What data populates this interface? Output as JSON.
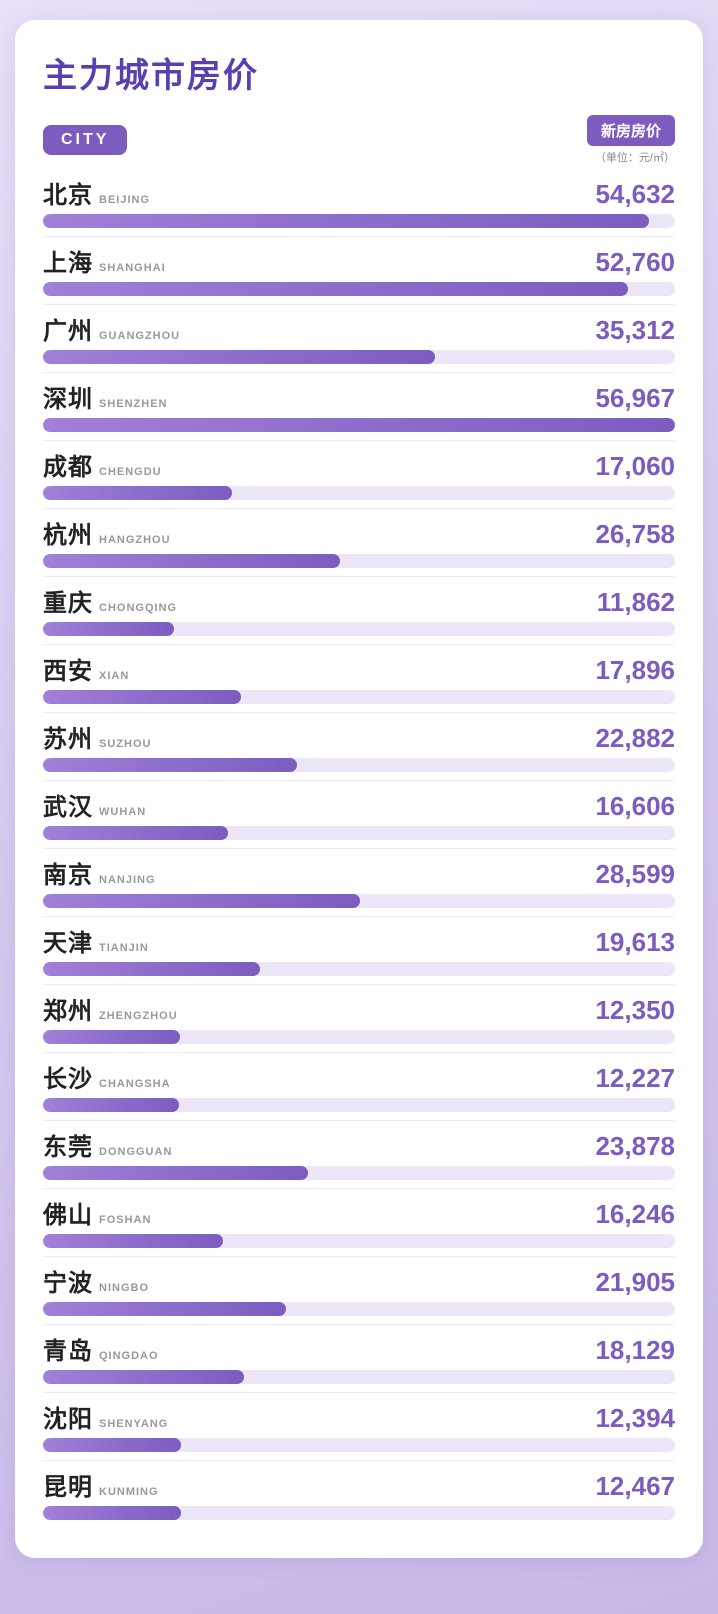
{
  "page": {
    "main_title": "主力城市房价",
    "city_badge": "CITY",
    "price_header": "新房房价",
    "price_unit": "（单位：元/㎡）",
    "max_price": 56967,
    "cities": [
      {
        "zh": "北京",
        "en": "BEIJING",
        "price": 54632
      },
      {
        "zh": "上海",
        "en": "SHANGHAI",
        "price": 52760
      },
      {
        "zh": "广州",
        "en": "GUANGZHOU",
        "price": 35312
      },
      {
        "zh": "深圳",
        "en": "SHENZHEN",
        "price": 56967
      },
      {
        "zh": "成都",
        "en": "CHENGDU",
        "price": 17060
      },
      {
        "zh": "杭州",
        "en": "HANGZHOU",
        "price": 26758
      },
      {
        "zh": "重庆",
        "en": "CHONGQING",
        "price": 11862
      },
      {
        "zh": "西安",
        "en": "XIAN",
        "price": 17896
      },
      {
        "zh": "苏州",
        "en": "SUZHOU",
        "price": 22882
      },
      {
        "zh": "武汉",
        "en": "WUHAN",
        "price": 16606
      },
      {
        "zh": "南京",
        "en": "NANJING",
        "price": 28599
      },
      {
        "zh": "天津",
        "en": "TIANJIN",
        "price": 19613
      },
      {
        "zh": "郑州",
        "en": "ZHENGZHOU",
        "price": 12350
      },
      {
        "zh": "长沙",
        "en": "CHANGSHA",
        "price": 12227
      },
      {
        "zh": "东莞",
        "en": "DONGGUAN",
        "price": 23878
      },
      {
        "zh": "佛山",
        "en": "FOSHAN",
        "price": 16246
      },
      {
        "zh": "宁波",
        "en": "NINGBO",
        "price": 21905
      },
      {
        "zh": "青岛",
        "en": "QINGDAO",
        "price": 18129
      },
      {
        "zh": "沈阳",
        "en": "SHENYANG",
        "price": 12394
      },
      {
        "zh": "昆明",
        "en": "KUNMING",
        "price": 12467
      }
    ]
  }
}
